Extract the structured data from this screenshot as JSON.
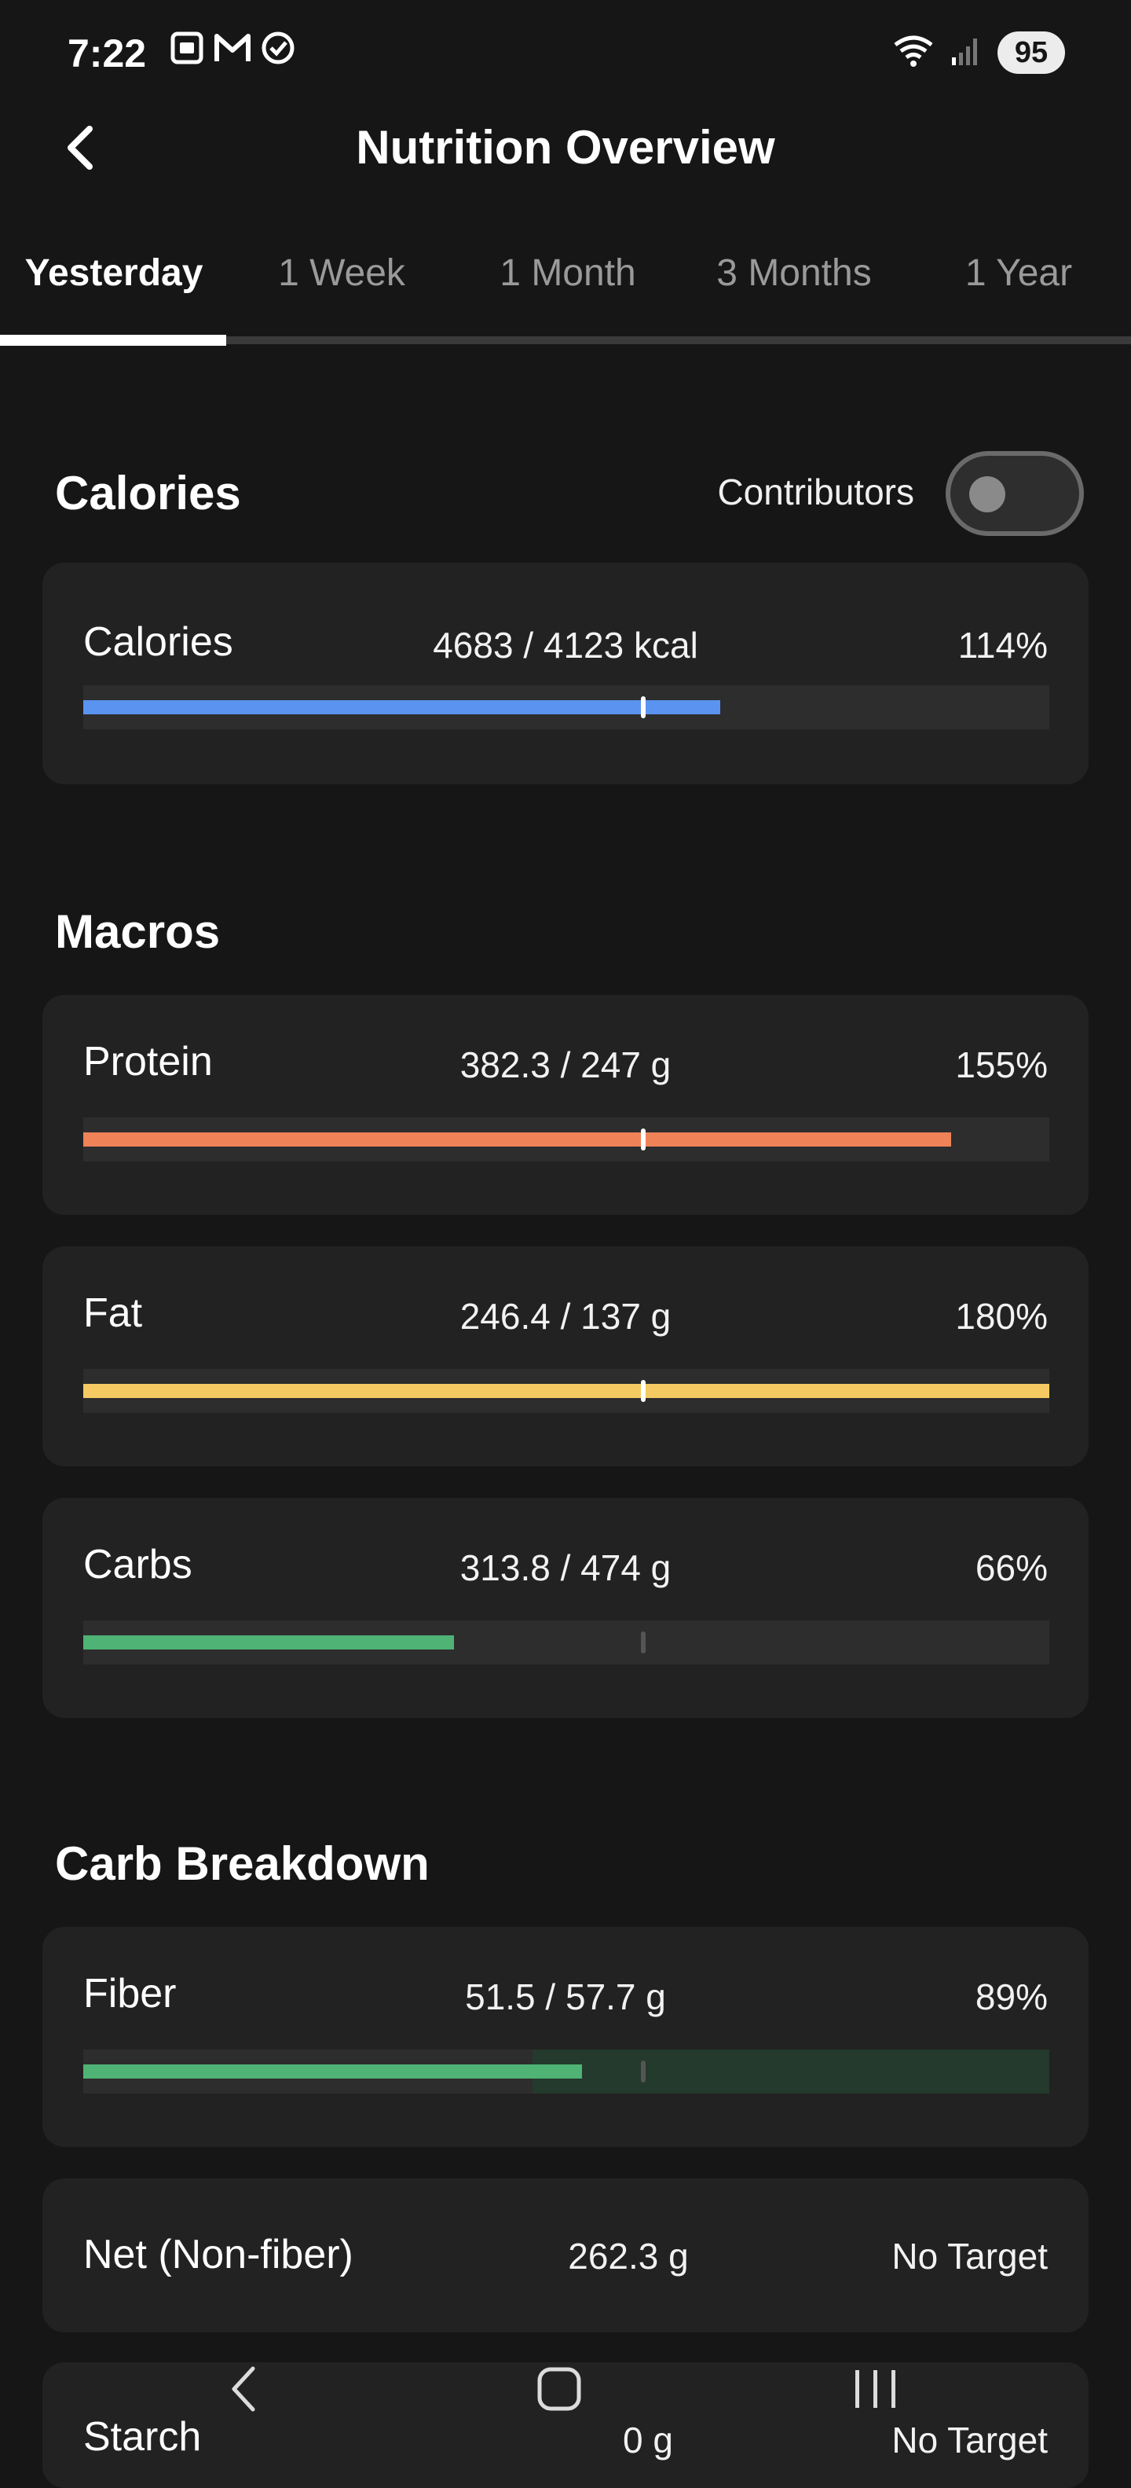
{
  "status_bar": {
    "time": "7:22",
    "battery": "95",
    "icons_left": [
      "screenshot-icon",
      "gmail-icon",
      "check-circle-icon"
    ],
    "icons_right": [
      "wifi-icon",
      "signal-icon"
    ]
  },
  "app_bar": {
    "title": "Nutrition Overview",
    "back_icon": "chevron-left-icon"
  },
  "tabs": [
    {
      "label": "Yesterday",
      "active": true
    },
    {
      "label": "1 Week",
      "active": false
    },
    {
      "label": "1 Month",
      "active": false
    },
    {
      "label": "3 Months",
      "active": false
    },
    {
      "label": "1 Year",
      "active": false
    }
  ],
  "calories_section": {
    "title": "Calories",
    "contributors_label": "Contributors",
    "contributors_on": false,
    "items": [
      {
        "label": "Calories",
        "amount": "4683 / 4123 kcal",
        "percent": "114%",
        "fill": 0.659,
        "target": 0.58,
        "color": "#5b93f0"
      }
    ]
  },
  "macros_section": {
    "title": "Macros",
    "items": [
      {
        "label": "Protein",
        "amount": "382.3 / 247 g",
        "percent": "155%",
        "fill": 0.898,
        "target": 0.58,
        "color": "#f08258"
      },
      {
        "label": "Fat",
        "amount": "246.4 / 137 g",
        "percent": "180%",
        "fill": 1.0,
        "target": 0.58,
        "color": "#f5ca62"
      },
      {
        "label": "Carbs",
        "amount": "313.8 / 474 g",
        "percent": "66%",
        "fill": 0.384,
        "target": 0.58,
        "color": "#4eb374"
      }
    ]
  },
  "carb_section": {
    "title": "Carb Breakdown",
    "fiber": {
      "label": "Fiber",
      "amount": "51.5 / 57.7 g",
      "percent": "89%",
      "fill": 0.516,
      "target": 0.58,
      "range_start": 0.465,
      "color": "#4eb374"
    },
    "net": {
      "label": "Net (Non-fiber)",
      "amount": "262.3 g",
      "percent": "No Target"
    },
    "starch": {
      "label": "Starch",
      "amount": "0 g",
      "percent": "No Target"
    }
  },
  "nav_bar": {
    "back_icon": "nav-back-icon",
    "home_icon": "nav-home-icon",
    "recents_icon": "nav-recents-icon"
  }
}
